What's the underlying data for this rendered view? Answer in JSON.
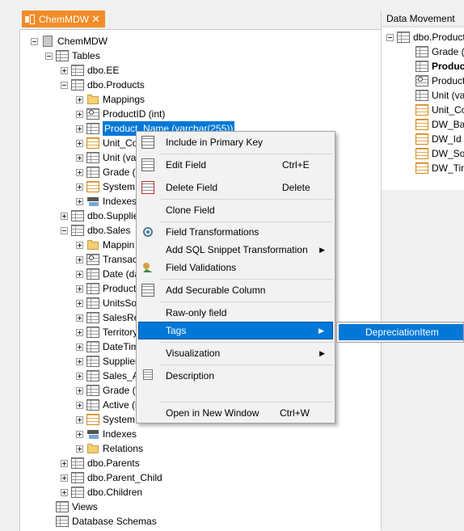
{
  "tab": {
    "title": "ChemMDW",
    "close": "✕"
  },
  "tree": {
    "root": "ChemMDW",
    "tables": "Tables",
    "items": [
      {
        "label": "dbo.EE"
      },
      {
        "label": "dbo.Products"
      },
      {
        "label": "Mappings"
      },
      {
        "label": "ProductID (int)"
      },
      {
        "label": "Product_Name (varchar(255))"
      },
      {
        "label": "Unit_Co"
      },
      {
        "label": "Unit (var"
      },
      {
        "label": "Grade (v"
      },
      {
        "label": "System"
      },
      {
        "label": "Indexes"
      },
      {
        "label": "dbo.Supplier"
      },
      {
        "label": "dbo.Sales"
      },
      {
        "label": "Mappin"
      },
      {
        "label": "Transac"
      },
      {
        "label": "Date (da"
      },
      {
        "label": "Product"
      },
      {
        "label": "UnitsSol"
      },
      {
        "label": "SalesRe"
      },
      {
        "label": "Territory"
      },
      {
        "label": "DateTim"
      },
      {
        "label": "Supplier"
      },
      {
        "label": "Sales_A"
      },
      {
        "label": "Grade (v"
      },
      {
        "label": "Active (b"
      },
      {
        "label": "System"
      },
      {
        "label": "Indexes"
      },
      {
        "label": "Relations"
      },
      {
        "label": "dbo.Parents"
      },
      {
        "label": "dbo.Parent_Child"
      },
      {
        "label": "dbo.Children"
      },
      {
        "label": "Views"
      },
      {
        "label": "Database Schemas"
      }
    ]
  },
  "right_panel": {
    "title": "Data Movement",
    "items": [
      {
        "label": "dbo.Products"
      },
      {
        "label": "Grade (v"
      },
      {
        "label": "Produc"
      },
      {
        "label": "ProductI"
      },
      {
        "label": "Unit (var"
      },
      {
        "label": "Unit_Cos"
      },
      {
        "label": "DW_Bat"
      },
      {
        "label": "DW_Id ("
      },
      {
        "label": "DW_Sou"
      },
      {
        "label": "DW_Tim"
      }
    ]
  },
  "context_menu": {
    "items": [
      {
        "label": "Include in Primary Key",
        "shortcut": ""
      },
      {
        "label": "Edit Field",
        "shortcut": "Ctrl+E"
      },
      {
        "label": "Delete Field",
        "shortcut": "Delete"
      },
      {
        "label": "Clone Field",
        "shortcut": ""
      },
      {
        "label": "Field Transformations",
        "shortcut": ""
      },
      {
        "label": "Add SQL Snippet Transformation",
        "shortcut": ""
      },
      {
        "label": "Field Validations",
        "shortcut": ""
      },
      {
        "label": "Add Securable Column",
        "shortcut": ""
      },
      {
        "label": "Raw-only field",
        "shortcut": ""
      },
      {
        "label": "Tags",
        "shortcut": ""
      },
      {
        "label": "Visualization",
        "shortcut": ""
      },
      {
        "label": "Description",
        "shortcut": ""
      },
      {
        "label": "Open in New Window",
        "shortcut": "Ctrl+W"
      }
    ],
    "arrow": "▶"
  },
  "submenu": {
    "items": [
      {
        "label": "DepreciationItem"
      }
    ]
  },
  "colors": {
    "accent": "#0078d7",
    "tab": "#f28c28"
  }
}
